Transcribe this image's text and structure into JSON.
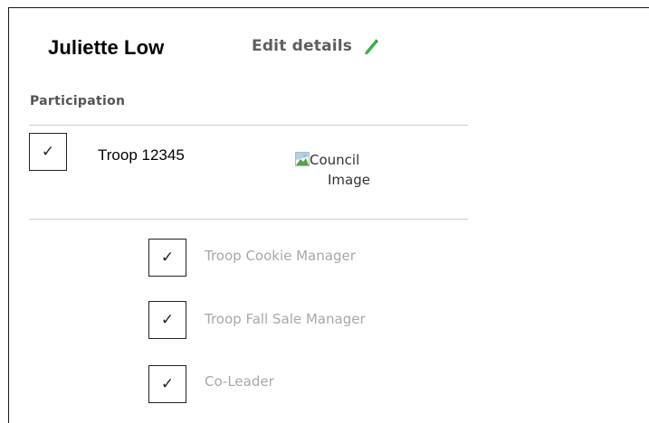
{
  "profile": {
    "name": "Juliette Low",
    "edit_label": "Edit details",
    "edit_icon": "pencil-icon",
    "accent_color": "#3cb04a"
  },
  "participation": {
    "section_title": "Participation",
    "troop": {
      "checked": true,
      "check_glyph": "✓",
      "name": "Troop 12345",
      "council_image_alt_line1": "Council",
      "council_image_alt_line2": "Image"
    },
    "roles": [
      {
        "checked": true,
        "check_glyph": "✓",
        "label": "Troop Cookie Manager"
      },
      {
        "checked": true,
        "check_glyph": "✓",
        "label": "Troop Fall Sale Manager"
      },
      {
        "checked": true,
        "check_glyph": "✓",
        "label": "Co-Leader"
      }
    ]
  }
}
